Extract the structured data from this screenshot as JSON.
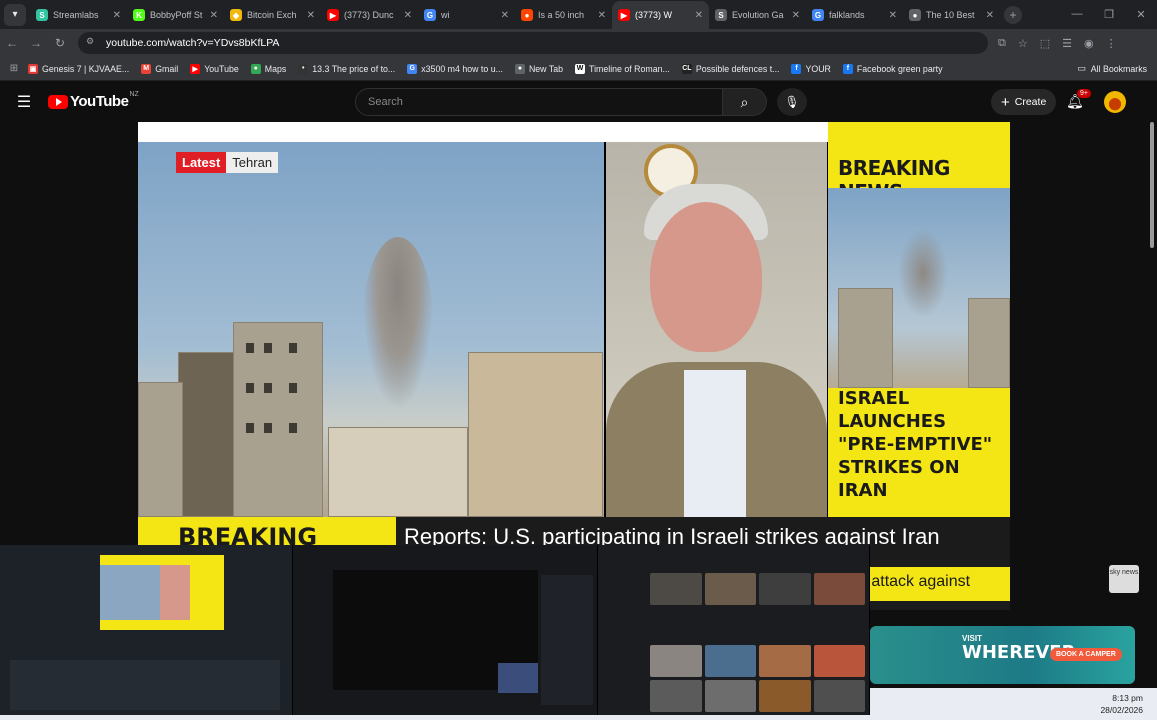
{
  "browser": {
    "tabs": [
      {
        "title": "Streamlabs",
        "color": "#31c3a2",
        "glyph": "S",
        "active": false
      },
      {
        "title": "BobbyPoff St",
        "color": "#53fc18",
        "glyph": "K",
        "active": false
      },
      {
        "title": "Bitcoin Exch",
        "color": "#f0b90b",
        "glyph": "◆",
        "active": false
      },
      {
        "title": "(3773) Dunc",
        "color": "#ff0000",
        "glyph": "▶",
        "active": false
      },
      {
        "title": "wi",
        "color": "#4285f4",
        "glyph": "G",
        "active": false
      },
      {
        "title": "Is a 50 inch",
        "color": "#ff4500",
        "glyph": "●",
        "active": false
      },
      {
        "title": "(3773) W",
        "color": "#ff0000",
        "glyph": "▶",
        "active": true
      },
      {
        "title": "Evolution Ga",
        "color": "#5f6368",
        "glyph": "S",
        "active": false
      },
      {
        "title": "falklands",
        "color": "#4285f4",
        "glyph": "G",
        "active": false
      },
      {
        "title": "The 10 Best",
        "color": "#5f6368",
        "glyph": "●",
        "active": false
      }
    ],
    "url": "youtube.com/watch?v=YDvs8bKfLPA",
    "bookmarks": [
      {
        "label": "Genesis 7 | KJVAAE...",
        "color": "#e53935",
        "glyph": "▣"
      },
      {
        "label": "Gmail",
        "color": "#ea4335",
        "glyph": "M"
      },
      {
        "label": "YouTube",
        "color": "#ff0000",
        "glyph": "▶"
      },
      {
        "label": "Maps",
        "color": "#34a853",
        "glyph": "●"
      },
      {
        "label": "13.3 The price of to...",
        "color": "#333333",
        "glyph": "•"
      },
      {
        "label": "x3500 m4 how to u...",
        "color": "#4285f4",
        "glyph": "G"
      },
      {
        "label": "New Tab",
        "color": "#5f6368",
        "glyph": "●"
      },
      {
        "label": "Timeline of Roman...",
        "color": "#ffffff",
        "glyph": "W"
      },
      {
        "label": "Possible defences t...",
        "color": "#222222",
        "glyph": "CL"
      },
      {
        "label": "YOUR",
        "color": "#1877f2",
        "glyph": "f"
      },
      {
        "label": "Facebook green party",
        "color": "#1877f2",
        "glyph": "f"
      }
    ],
    "all_bookmarks": "All Bookmarks"
  },
  "youtube": {
    "logo_text": "YouTube",
    "country_code": "NZ",
    "search_placeholder": "Search",
    "create_label": "Create",
    "notification_badge": "9+"
  },
  "video": {
    "latest_label": "Latest",
    "location_label": "Tehran",
    "breaking_news": "BREAKING NEWS",
    "side_headline": "ISRAEL LAUNCHES \"PRE-EMPTIVE\" STRIKES ON IRAN",
    "ticker_label": "BREAKING NEWS",
    "ticker_headline": "Reports: U.S. participating in Israeli strikes against Iran",
    "ticker_sub": "tive attack against",
    "channel_logo": "sky news"
  },
  "ad": {
    "visit": "VISIT",
    "tagline": "WHEREVER",
    "cta": "BOOK A CAMPER"
  },
  "taskbar": {
    "time": "8:13 pm",
    "date": "28/02/2026"
  }
}
